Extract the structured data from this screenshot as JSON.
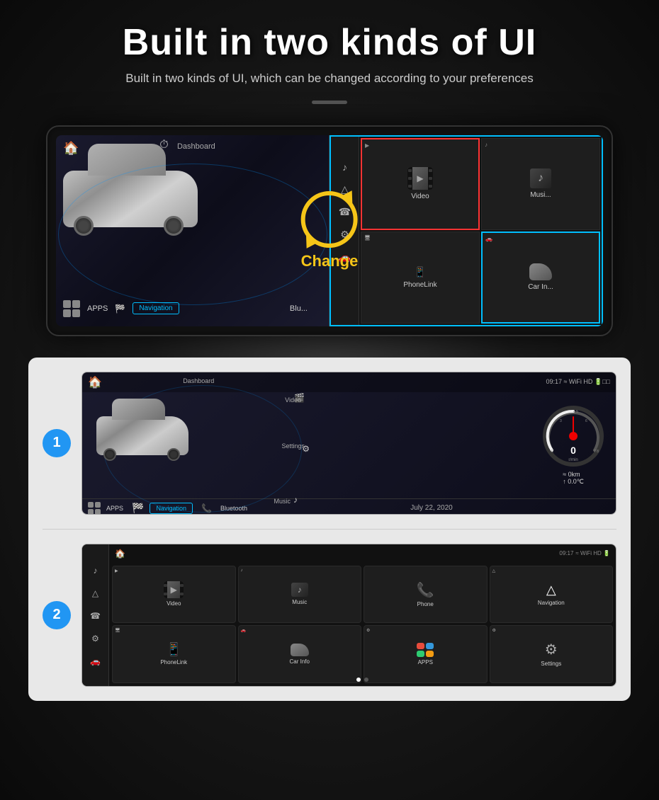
{
  "header": {
    "title": "Built in two kinds of UI",
    "subtitle": "Built in two kinds of UI, which can be changed according to your preferences"
  },
  "combined": {
    "left_home_icon": "🏠",
    "right_home_icon": "🏠",
    "dashboard_label": "Dashboard",
    "change_label": "Change",
    "left_apps_label": "APPS",
    "left_nav_label": "Navigation",
    "left_bluetooth_label": "Blu...",
    "right_video_label": "Video",
    "right_music_label": "Musi...",
    "right_phonelink_label": "PhoneLink",
    "right_carinfo_label": "Car In..."
  },
  "ui1": {
    "number": "1",
    "home_icon": "🏠",
    "topbar_time": "09:17",
    "topbar_right": "WiFi HD",
    "dashboard_label": "Dashboard",
    "video_label": "Video",
    "settings_label": "Settings",
    "music_label": "Music",
    "bluetooth_label": "Bluetooth",
    "apps_label": "APPS",
    "nav_label": "Navigation",
    "date_label": "July 22, 2020",
    "speedo_value": "0",
    "speedo_unit": "r/min",
    "stat_km": "≈ 0km",
    "stat_temp": "↑ 0.0℃"
  },
  "ui2": {
    "number": "2",
    "home_icon": "🏠",
    "topbar_time": "09:17",
    "topbar_right": "WiFi HD",
    "video_label": "Video",
    "music_label": "Music",
    "phone_label": "Phone",
    "navigation_label": "Navigation",
    "phonelink_label": "PhoneLink",
    "carinfo_label": "Car Info",
    "apps_label": "APPS",
    "settings_label": "Settings",
    "sidebar_icons": [
      "♪",
      "△",
      "☎",
      "⚙",
      "🚗"
    ]
  }
}
